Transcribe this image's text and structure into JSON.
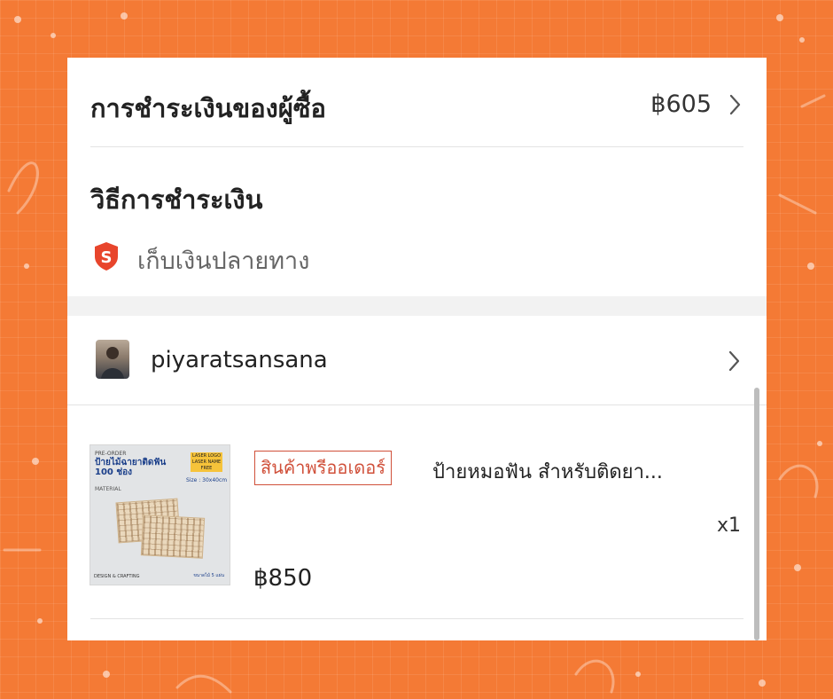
{
  "buyer_payment": {
    "label": "การชำระเงินของผู้ซื้อ",
    "amount": "฿605"
  },
  "payment_method": {
    "title": "วิธีการชำระเงิน",
    "icon": "shopee-shield-icon",
    "value": "เก็บเงินปลายทาง",
    "icon_color": "#e8452c"
  },
  "seller": {
    "name": "piyaratsansana"
  },
  "product": {
    "tag": "สินค้าพรีออเดอร์",
    "title": "ป้ายหมอฟัน สำหรับติดยา...",
    "quantity": "x1",
    "price": "฿850",
    "thumbnail": {
      "top_text": "PRE-ORDER",
      "headline": "ป้ายไม้ฉายาติดฟัน 100 ช่อง",
      "sub_text": "MATERIAL",
      "badge": "LASER LOGO LASER NAME FREE",
      "size_text": "Size : 30x40cm",
      "footer_left": "DESIGN & CRAFTING",
      "footer_right": "ขนาดไม้ 5 แผ่น"
    }
  },
  "colors": {
    "background": "#f47a35",
    "accent": "#d0503a"
  }
}
